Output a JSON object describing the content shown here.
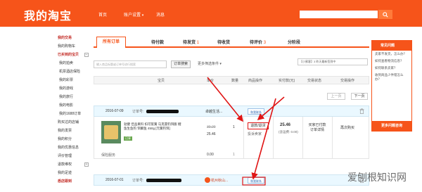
{
  "header": {
    "logo": "我的淘宝",
    "nav": [
      "首页",
      "账户设置",
      "消息"
    ],
    "chevron": "▾",
    "search_placeholder": ""
  },
  "sidebar": {
    "items": [
      {
        "label": "我的交易",
        "head": true
      },
      {
        "label": "我的购物车"
      },
      {
        "label": "已买到的宝贝",
        "head": true,
        "toggle": "−"
      },
      {
        "label": "我的拍卖",
        "sub": true
      },
      {
        "label": "机票酒店保险",
        "sub": true
      },
      {
        "label": "我的彩票",
        "sub": true
      },
      {
        "label": "我的游戏",
        "sub": true
      },
      {
        "label": "我的旅行",
        "sub": true
      },
      {
        "label": "我的电影",
        "sub": true
      },
      {
        "label": "我的1688订单",
        "sub": true
      },
      {
        "label": "购买过的店铺"
      },
      {
        "label": "我的发票"
      },
      {
        "label": "我的积分"
      },
      {
        "label": "我的优惠信息"
      },
      {
        "label": "评价管理"
      },
      {
        "label": "退款维权",
        "toggle": "+"
      },
      {
        "label": "我的足迹"
      },
      {
        "label": "悉店跟到",
        "head": true
      }
    ]
  },
  "tabs": [
    {
      "label": "所有订单",
      "active": true
    },
    {
      "label": "待付款"
    },
    {
      "label": "待发货",
      "count": "1"
    },
    {
      "label": "待收货"
    },
    {
      "label": "待评价",
      "count": "3"
    },
    {
      "label": "分阶段"
    }
  ],
  "filters": {
    "input_placeholder": "输入商品标题或订单号进行搜索",
    "search_button": "订单搜索",
    "more": "更多筛选条件 ▾",
    "hint": "【小蜜客】3 昨天最新签到中"
  },
  "columns": [
    "宝贝",
    "单价",
    "数量",
    "商品操作",
    "实付款(元)",
    "交易状态",
    "交易操作"
  ],
  "pager": {
    "prev": "上一页",
    "next": "下一页"
  },
  "orders": [
    {
      "date": "2016-07-09",
      "order_label": "订单号:",
      "shop": "卓越生活...",
      "chat": "和我联系",
      "product_title": "勃健 佳品果料 扣可筐簧 马克雷钓饵膨 鲤鱼生鱼钓 饵鲫鱼 450g [元簧钓饵]",
      "product_badge": "已享",
      "price_old": "30.20",
      "price_new": "25.46",
      "quantity": "1",
      "action_refund": "退款/退货",
      "action_complain": "投诉卖家",
      "paid": "25.46",
      "freight": "(含运费: 0.00)",
      "status": "买家已付款 订单详情",
      "buy_again": "再次购买",
      "insurance": "保险服务",
      "ins_price": "0.00",
      "ins_qty": "1"
    },
    {
      "date": "2016-07-01",
      "order_label": "订单号:",
      "shop": "杭州秋山...",
      "chat": "和我联系"
    }
  ],
  "help": {
    "title": "常见问题",
    "questions": [
      "卖家不发货，怎么办？",
      "如何查看物流信息？",
      "如何联系卖家？",
      "收到商品少件错怎么办？"
    ],
    "more": "更多问题咨询"
  },
  "watermark": "爱刨根知识网",
  "colors": {
    "brand": "#f6541a",
    "annotation": "#e01515"
  }
}
